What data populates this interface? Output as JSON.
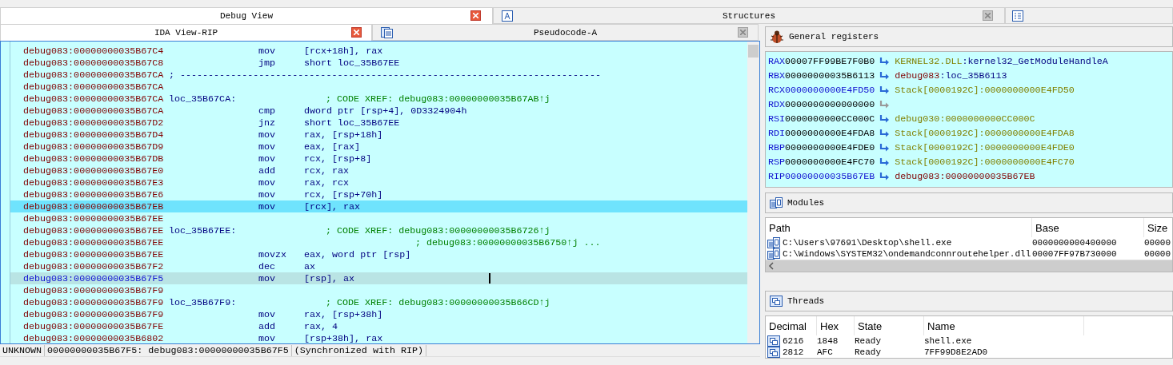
{
  "top_tabs": [
    {
      "label": "Debug View",
      "selected": true
    },
    {
      "label": "Structures",
      "selected": false
    },
    {
      "selected": false,
      "kind": "stub"
    }
  ],
  "view_tabs": [
    {
      "label": "IDA View-RIP",
      "selected": true
    },
    {
      "label": "Pseudocode-A",
      "selected": false
    }
  ],
  "disassembly": [
    {
      "address": "debug083:00000000035B67C4",
      "mnemonic": "mov",
      "operand": "[rcx+18h], rax",
      "current": false,
      "selected": false
    },
    {
      "address": "debug083:00000000035B67C8",
      "mnemonic": "jmp",
      "operand": "short loc_35B67EE",
      "current": false,
      "selected": false
    },
    {
      "address": "debug083:00000000035B67CA",
      "separator": "; ---------------------------------------------------------------------------",
      "current": false,
      "selected": false
    },
    {
      "address": "debug083:00000000035B67CA",
      "current": false,
      "selected": false
    },
    {
      "address": "debug083:00000000035B67CA",
      "label": "loc_35B67CA:",
      "comment": "; CODE XREF: debug083:00000000035B67AB↑j",
      "current": false,
      "selected": false
    },
    {
      "address": "debug083:00000000035B67CA",
      "mnemonic": "cmp",
      "operand": "dword ptr [rsp+4], 0D3324904h",
      "current": false,
      "selected": false
    },
    {
      "address": "debug083:00000000035B67D2",
      "mnemonic": "jnz",
      "operand": "short loc_35B67EE",
      "current": false,
      "selected": false
    },
    {
      "address": "debug083:00000000035B67D4",
      "mnemonic": "mov",
      "operand": "rax, [rsp+18h]",
      "current": false,
      "selected": false
    },
    {
      "address": "debug083:00000000035B67D9",
      "mnemonic": "mov",
      "operand": "eax, [rax]",
      "current": false,
      "selected": false
    },
    {
      "address": "debug083:00000000035B67DB",
      "mnemonic": "mov",
      "operand": "rcx, [rsp+8]",
      "current": false,
      "selected": false
    },
    {
      "address": "debug083:00000000035B67E0",
      "mnemonic": "add",
      "operand": "rcx, rax",
      "current": false,
      "selected": false
    },
    {
      "address": "debug083:00000000035B67E3",
      "mnemonic": "mov",
      "operand": "rax, rcx",
      "current": false,
      "selected": false
    },
    {
      "address": "debug083:00000000035B67E6",
      "mnemonic": "mov",
      "operand": "rcx, [rsp+70h]",
      "current": false,
      "selected": false
    },
    {
      "address": "debug083:00000000035B67EB",
      "mnemonic": "mov",
      "operand": "[rcx], rax",
      "current": true,
      "selected": false
    },
    {
      "address": "debug083:00000000035B67EE",
      "current": false,
      "selected": false
    },
    {
      "address": "debug083:00000000035B67EE",
      "label": "loc_35B67EE:",
      "comment": "; CODE XREF: debug083:00000000035B6726↑j",
      "current": false,
      "selected": false
    },
    {
      "address": "debug083:00000000035B67EE",
      "comment": "; debug083:00000000035B6750↑j ...",
      "current": false,
      "selected": false
    },
    {
      "address": "debug083:00000000035B67EE",
      "mnemonic": "movzx",
      "operand": "eax, word ptr [rsp]",
      "current": false,
      "selected": false
    },
    {
      "address": "debug083:00000000035B67F2",
      "mnemonic": "dec",
      "operand": "ax",
      "current": false,
      "selected": false
    },
    {
      "address": "debug083:00000000035B67F5",
      "mnemonic": "mov",
      "operand": "[rsp], ax",
      "current": false,
      "selected": true
    },
    {
      "address": "debug083:00000000035B67F9",
      "current": false,
      "selected": false
    },
    {
      "address": "debug083:00000000035B67F9",
      "label": "loc_35B67F9:",
      "comment": "; CODE XREF: debug083:00000000035B66CD↑j",
      "current": false,
      "selected": false
    },
    {
      "address": "debug083:00000000035B67F9",
      "mnemonic": "mov",
      "operand": "rax, [rsp+38h]",
      "current": false,
      "selected": false
    },
    {
      "address": "debug083:00000000035B67FE",
      "mnemonic": "add",
      "operand": "rax, 4",
      "current": false,
      "selected": false
    },
    {
      "address": "debug083:00000000035B6802",
      "mnemonic": "mov",
      "operand": "[rsp+38h], rax",
      "current": false,
      "selected": false
    }
  ],
  "status_bar": [
    "UNKNOWN",
    "00000000035B67F5: debug083:00000000035B67F5",
    "(Synchronized with RIP)"
  ],
  "registers": {
    "title": "General registers",
    "rows": [
      {
        "name": "RAX",
        "value": "00007FF99BE7F0B0",
        "changed": false,
        "segment": "KERNEL32.DLL",
        "target": ":kernel32_GetModuleHandleA",
        "kind": "library"
      },
      {
        "name": "RBX",
        "value": "00000000035B6113",
        "changed": false,
        "segment": "debug083",
        "target": ":loc_35B6113",
        "kind": "code"
      },
      {
        "name": "RCX",
        "value": "0000000000E4FD50",
        "changed": true,
        "segment": "Stack[0000192C]",
        "target": ":0000000000E4FD50",
        "kind": "data"
      },
      {
        "name": "RDX",
        "value": "0000000000000000",
        "changed": false,
        "kind": "none"
      },
      {
        "name": "RSI",
        "value": "0000000000CC000C",
        "changed": false,
        "segment": "debug030",
        "target": ":0000000000CC000C",
        "kind": "data"
      },
      {
        "name": "RDI",
        "value": "0000000000E4FDA8",
        "changed": false,
        "segment": "Stack[0000192C]",
        "target": ":0000000000E4FDA8",
        "kind": "data"
      },
      {
        "name": "RBP",
        "value": "0000000000E4FDE0",
        "changed": false,
        "segment": "Stack[0000192C]",
        "target": ":0000000000E4FDE0",
        "kind": "data"
      },
      {
        "name": "RSP",
        "value": "0000000000E4FC70",
        "changed": false,
        "segment": "Stack[0000192C]",
        "target": ":0000000000E4FC70",
        "kind": "data"
      },
      {
        "name": "RIP",
        "value": "00000000035B67EB",
        "changed": true,
        "segment": "debug083",
        "target": ":00000000035B67EB",
        "kind": "codeaddr"
      }
    ]
  },
  "modules": {
    "title": "Modules",
    "columns": [
      "Path",
      "Base",
      "Size"
    ],
    "rows": [
      [
        "C:\\Users\\97691\\Desktop\\shell.exe",
        "0000000000400000",
        "00000"
      ],
      [
        "C:\\Windows\\SYSTEM32\\ondemandconnroutehelper.dll",
        "00007FF97B730000",
        "00000"
      ]
    ]
  },
  "threads": {
    "title": "Threads",
    "columns": [
      "Decimal",
      "Hex",
      "State",
      "Name"
    ],
    "rows": [
      [
        "6216",
        "1848",
        "Ready",
        "shell.exe"
      ],
      [
        "2812",
        "AFC",
        "Ready",
        "7FF99D8E2AD0"
      ]
    ]
  }
}
